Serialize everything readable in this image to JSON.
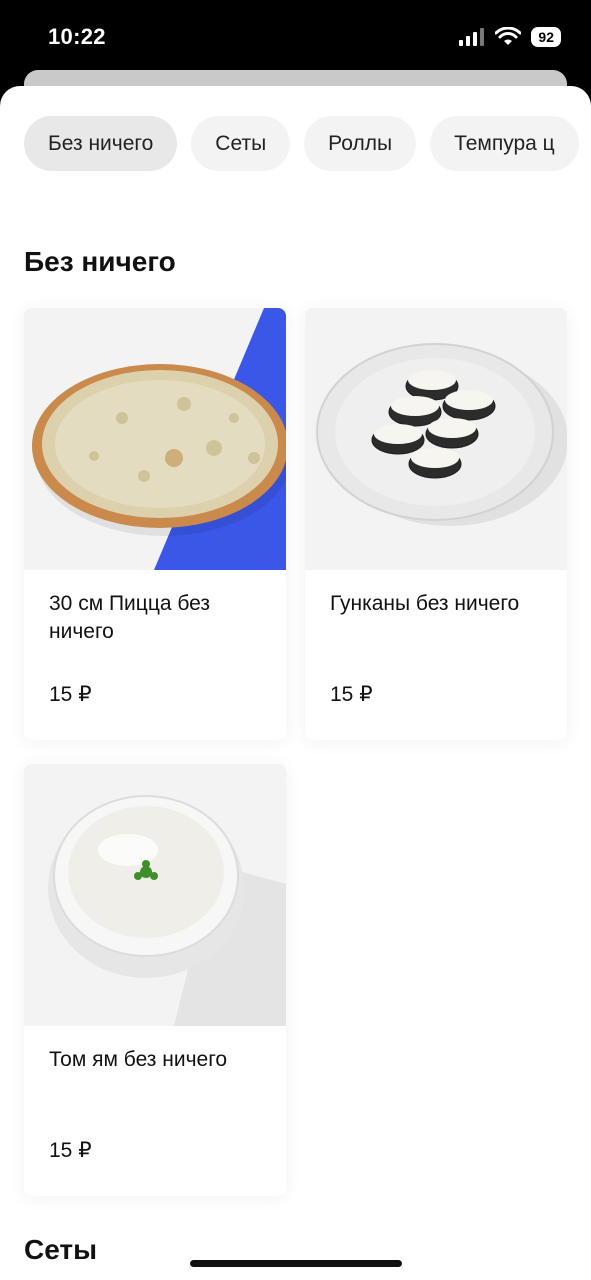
{
  "status_bar": {
    "time": "10:22",
    "battery": "92",
    "icons": [
      "signal-icon",
      "wifi-icon",
      "battery-icon"
    ]
  },
  "categories": [
    {
      "label": "Без ничего",
      "active": true
    },
    {
      "label": "Сеты",
      "active": false
    },
    {
      "label": "Роллы",
      "active": false
    },
    {
      "label": "Темпура ц",
      "active": false
    }
  ],
  "sections": [
    {
      "title": "Без ничего",
      "products": [
        {
          "name": "30 см Пицца без ничего",
          "price": "15 ₽",
          "image": "pizza-image"
        },
        {
          "name": "Гунканы без ничего",
          "price": "15 ₽",
          "image": "gunkan-plate-image"
        },
        {
          "name": "Том ям без ничего",
          "price": "15 ₽",
          "image": "tom-yam-bowl-image"
        }
      ]
    },
    {
      "title": "Сеты"
    }
  ],
  "colors": {
    "accent_blue": "#3a57e8",
    "chip_bg": "#f3f3f3",
    "card_bg": "#ffffff",
    "image_bg": "#f3f3f3"
  }
}
